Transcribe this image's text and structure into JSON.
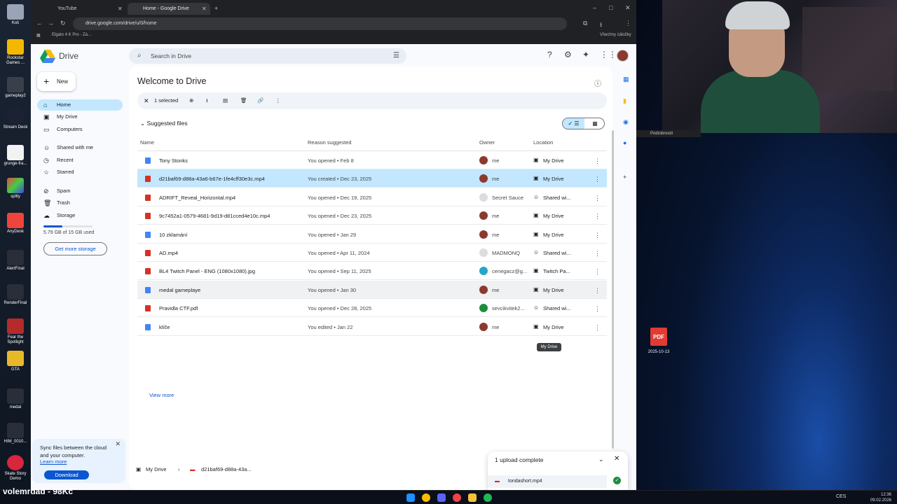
{
  "browser": {
    "tabs": [
      {
        "label": "YouTube",
        "active": false
      },
      {
        "label": "Home - Google Drive",
        "active": true
      }
    ],
    "url": "drive.google.com/drive/u/0/home",
    "bookmark": "Elgato 4 K Pro - Zá...",
    "all_bookmarks": "Všechny záložky"
  },
  "drive": {
    "brand": "Drive",
    "search_placeholder": "Search in Drive",
    "new_label": "New",
    "nav": [
      {
        "label": "Home",
        "icon": "home-icon",
        "selected": true
      },
      {
        "label": "My Drive",
        "icon": "my-drive-icon",
        "selected": false
      },
      {
        "label": "Computers",
        "icon": "computer-icon",
        "selected": false
      },
      {
        "label": "Shared with me",
        "icon": "people-icon",
        "selected": false
      },
      {
        "label": "Recent",
        "icon": "clock-icon",
        "selected": false
      },
      {
        "label": "Starred",
        "icon": "star-icon",
        "selected": false
      },
      {
        "label": "Spam",
        "icon": "spam-icon",
        "selected": false
      },
      {
        "label": "Trash",
        "icon": "trash-icon",
        "selected": false
      },
      {
        "label": "Storage",
        "icon": "cloud-icon",
        "selected": false
      }
    ],
    "storage_used": "5.79 GB of 15 GB used",
    "storage_fraction": 0.386,
    "get_storage": "Get more storage",
    "sync": {
      "text": "Sync files between the cloud and your computer.",
      "learn_more": "Learn more",
      "download": "Download"
    },
    "welcome": "Welcome to Drive",
    "selection": "1 selected",
    "suggested": "Suggested files",
    "columns": {
      "name": "Name",
      "reason": "Reason suggested",
      "owner": "Owner",
      "location": "Location"
    },
    "files": [
      {
        "name": "Tony Stonks",
        "type": "doc",
        "reason": "You opened • Feb 8",
        "owner": "me",
        "location": "My Drive",
        "loc_icon": "my-drive-icon"
      },
      {
        "name": "d21baf69-d88a-43a6-b67e-1fe4cff30e3c.mp4",
        "type": "video",
        "reason": "You created • Dec 23, 2025",
        "owner": "me",
        "location": "My Drive",
        "loc_icon": "my-drive-icon",
        "selected": true
      },
      {
        "name": "ADRIFT_Reveal_Horizontal.mp4",
        "type": "video",
        "reason": "You opened • Dec 19, 2025",
        "owner": "Secret Sauce",
        "location": "Shared wi...",
        "loc_icon": "shared-icon"
      },
      {
        "name": "9c7452a1-0579-4681-9d19-d81cced4e10c.mp4",
        "type": "video",
        "reason": "You opened • Dec 23, 2025",
        "owner": "me",
        "location": "My Drive",
        "loc_icon": "my-drive-icon"
      },
      {
        "name": "10 zklamání",
        "type": "doc",
        "reason": "You opened • Jan 29",
        "owner": "me",
        "location": "My Drive",
        "loc_icon": "my-drive-icon"
      },
      {
        "name": "AD.mp4",
        "type": "video",
        "reason": "You opened • Apr 11, 2024",
        "owner": "MADMONQ",
        "location": "Shared wi...",
        "loc_icon": "shared-icon"
      },
      {
        "name": "BL4 Twitch Panel - ENG (1080x1080).jpg",
        "type": "image",
        "reason": "You opened • Sep 11, 2025",
        "owner": "cenegacz@g...",
        "location": "Twitch Pa...",
        "loc_icon": "folder-icon"
      },
      {
        "name": "medal gameplaye",
        "type": "doc",
        "reason": "You opened • Jan 30",
        "owner": "me",
        "location": "My Drive",
        "loc_icon": "my-drive-icon",
        "hover": true
      },
      {
        "name": "Pravidla CTF.pdf",
        "type": "pdf",
        "reason": "You opened • Dec 28, 2025",
        "owner": "sevcikvitek2...",
        "location": "Shared wi...",
        "loc_icon": "shared-icon"
      },
      {
        "name": "klíče",
        "type": "doc",
        "reason": "You edited • Jan 22",
        "owner": "me",
        "location": "My Drive",
        "loc_icon": "my-drive-icon"
      }
    ],
    "view_more": "View more",
    "tooltip": "My Drive",
    "breadcrumb": [
      "My Drive",
      "d21baf69-d88a-43a..."
    ],
    "upload": {
      "title": "1 upload complete",
      "file": "tondashort.mp4"
    }
  },
  "desktop": {
    "icons": [
      "Koš",
      "Rockstar Games ...",
      "gameplay2",
      "Stream Deck",
      "grunge-fra...",
      "splity",
      "AnyDesk",
      "AlertFinal",
      "RenderFinal",
      "Fear the Spotlight",
      "GTA",
      "medal",
      "HIM_0010...",
      "Skate Story Demo"
    ],
    "pdf_label": "2025-10-13",
    "side_window": "Podrobnosti"
  },
  "taskbar": {
    "overlay": "volemrdad - 98Kč",
    "lang": "CES",
    "time": "12:36",
    "date": "09.02.2026"
  }
}
